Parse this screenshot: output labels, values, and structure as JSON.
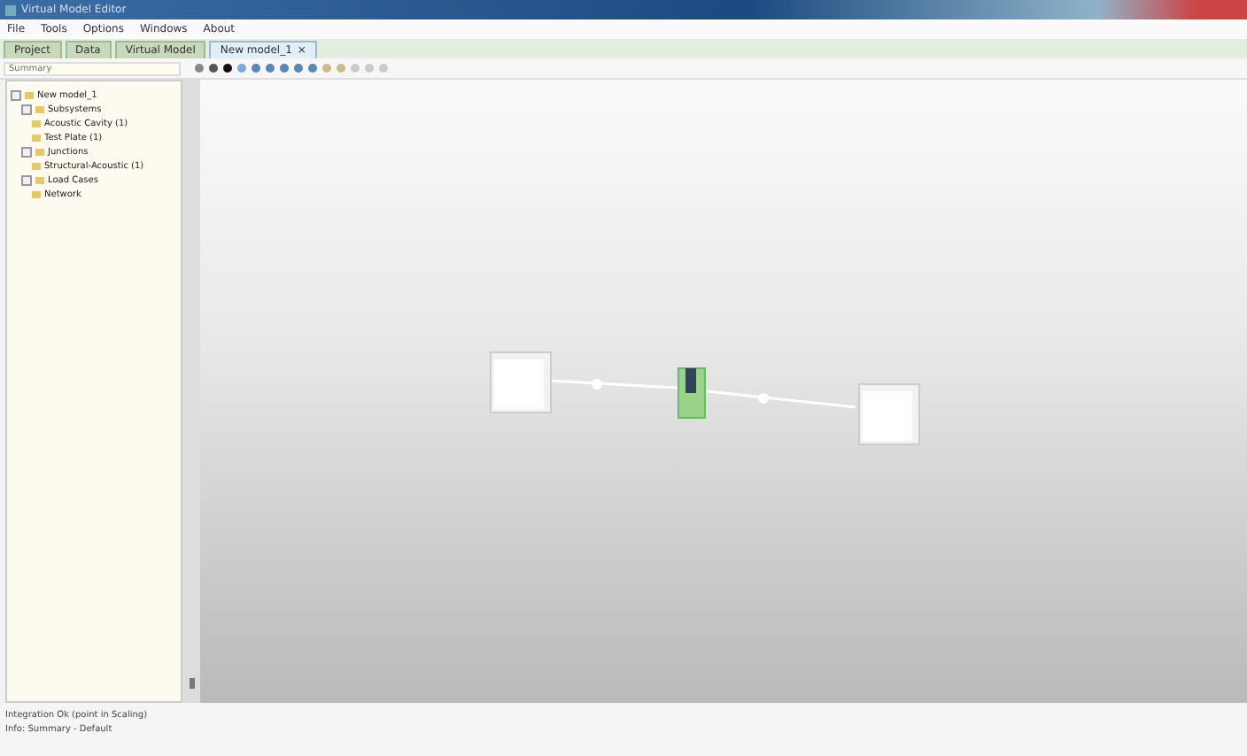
{
  "window": {
    "title": "Virtual Model Editor"
  },
  "menu": [
    "File",
    "Tools",
    "Options",
    "Windows",
    "About"
  ],
  "tabs": [
    {
      "label": "Project",
      "selected": false
    },
    {
      "label": "Data",
      "selected": false
    },
    {
      "label": "Virtual Model",
      "selected": false
    },
    {
      "label": "New model_1",
      "selected": true,
      "close": "×"
    }
  ],
  "search": {
    "placeholder": "Summary"
  },
  "tree": [
    {
      "label": "New model_1",
      "expanded": true,
      "children": [
        {
          "label": "Subsystems",
          "expanded": true,
          "children": [
            {
              "label": "Acoustic Cavity (1)"
            },
            {
              "label": "Test Plate (1)"
            }
          ]
        },
        {
          "label": "Junctions",
          "expanded": true,
          "children": [
            {
              "label": "Structural-Acoustic (1)"
            }
          ]
        },
        {
          "label": "Load Cases",
          "expanded": true,
          "children": [
            {
              "label": "Network"
            }
          ]
        }
      ]
    }
  ],
  "status_bar": [
    "Integration Ok (point in Scaling)",
    "Info: Summary - Default"
  ]
}
